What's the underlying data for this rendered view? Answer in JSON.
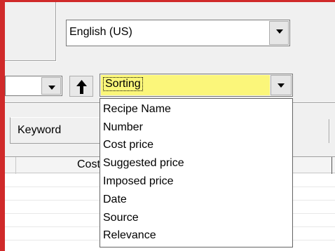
{
  "language": {
    "value": "English (US)"
  },
  "sort": {
    "value": "Sorting",
    "options": [
      "Recipe Name",
      "Number",
      "Cost price",
      "Suggested price",
      "Imposed price",
      "Date",
      "Source",
      "Relevance"
    ],
    "highlight_color": "#fbf67a"
  },
  "tabs": {
    "keyword": "Keyword"
  },
  "columns": {
    "cost": "Cost"
  },
  "colors": {
    "frame": "#d02a2a",
    "face": "#f0f0f0"
  }
}
